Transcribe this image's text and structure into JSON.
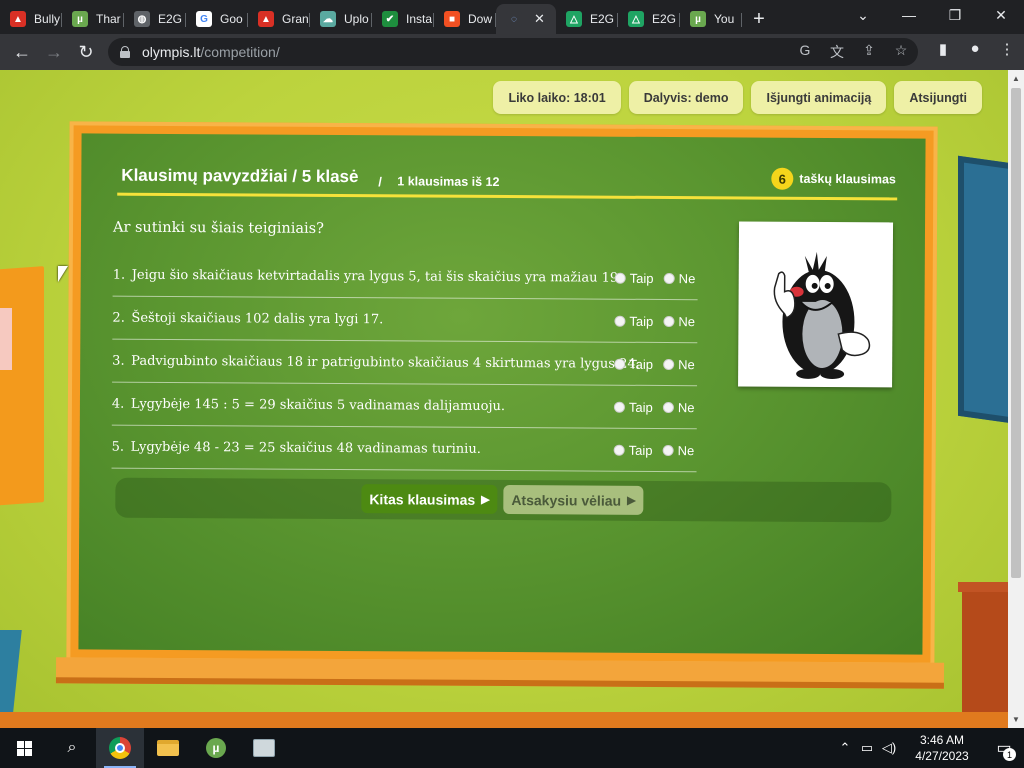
{
  "browser": {
    "tabs": [
      {
        "label": "Bully",
        "icon": "red-app-icon",
        "color": "#d93025",
        "glyph": "▲"
      },
      {
        "label": "Thar",
        "icon": "utorrent-icon",
        "color": "#6aa84f",
        "glyph": "µ"
      },
      {
        "label": "E2G",
        "icon": "globe-icon",
        "color": "#5f6368",
        "glyph": "◍"
      },
      {
        "label": "Goo",
        "icon": "google-icon",
        "color": "#ffffff",
        "glyph": "G"
      },
      {
        "label": "Gran",
        "icon": "red-app-icon",
        "color": "#d93025",
        "glyph": "▲"
      },
      {
        "label": "Uplo",
        "icon": "cloud-icon",
        "color": "#5aa9a0",
        "glyph": "☁"
      },
      {
        "label": "Insta",
        "icon": "shield-icon",
        "color": "#1e8e3e",
        "glyph": "✔"
      },
      {
        "label": "Dow",
        "icon": "microsoft-icon",
        "color": "#f25022",
        "glyph": "■"
      },
      {
        "label": "",
        "icon": "loading-icon",
        "color": "#35363a",
        "glyph": "◌",
        "active": true
      },
      {
        "label": "E2G",
        "icon": "drive-icon",
        "color": "#1fa463",
        "glyph": "△"
      },
      {
        "label": "E2G",
        "icon": "drive-icon",
        "color": "#1fa463",
        "glyph": "△"
      },
      {
        "label": "You",
        "icon": "utorrent-icon",
        "color": "#6aa84f",
        "glyph": "µ"
      }
    ],
    "url_host": "olympis.lt",
    "url_path": "/competition/"
  },
  "topbar": {
    "time_left": "Liko laiko: 18:01",
    "participant": "Dalyvis: demo",
    "toggle_animation": "Išjungti animaciją",
    "logout": "Atsijungti"
  },
  "question": {
    "title": "Klausimų pavyzdžiai / 5 klasė",
    "separator": "/",
    "counter": "1 klausimas iš 12",
    "points": "6",
    "points_label": "taškų klausimas",
    "prompt": "Ar sutinki su šiais teiginiais?",
    "yes_label": "Taip",
    "no_label": "Ne",
    "statements": [
      {
        "num": "1.",
        "text": "Jeigu šio skaičiaus ketvirtadalis yra lygus 5, tai šis skaičius yra mažiau 19."
      },
      {
        "num": "2.",
        "text": "Šeštoji skaičiaus 102 dalis yra lygi 17."
      },
      {
        "num": "3.",
        "text": "Padvigubinto skaičiaus 18 ir patrigubinto skaičiaus 4 skirtumas yra lygus 24."
      },
      {
        "num": "4.",
        "text": "Lygybėje 145 : 5 = 29 skaičius 5 vadinamas dalijamuoju."
      },
      {
        "num": "5.",
        "text": "Lygybėje 48 - 23 = 25 skaičius 48 vadinamas turiniu."
      }
    ],
    "next_button": "Kitas klausimas",
    "later_button": "Atsakysiu vėliau",
    "play_glyph": "▶"
  },
  "taskbar": {
    "time": "3:46 AM",
    "date": "4/27/2023",
    "notifications": "1"
  },
  "colors": {
    "board_green": "#5b9630",
    "frame_orange": "#f59b22",
    "pill_bg": "#eef0a6",
    "underline_yellow": "#f5e23a",
    "next_green": "#4d8a12"
  }
}
